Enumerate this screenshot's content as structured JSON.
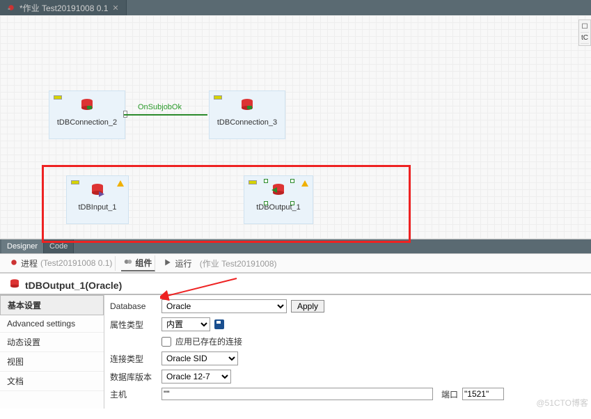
{
  "top_tab": {
    "title": "*作业 Test20191008 0.1"
  },
  "side_mini": {
    "item1": "☐",
    "item2": "tC"
  },
  "nodes": {
    "conn2": "tDBConnection_2",
    "conn3": "tDBConnection_3",
    "input1": "tDBInput_1",
    "output1": "tDBOutput_1"
  },
  "link": {
    "label": "OnSubjobOk"
  },
  "mini_tabs": {
    "designer": "Designer",
    "code": "Code"
  },
  "panel_tabs": {
    "proc_prefix": "进程",
    "proc_detail": "(Test20191008 0.1)",
    "component": "组件",
    "run": "运行",
    "run_detail": "(作业 Test20191008)"
  },
  "comp_title": "tDBOutput_1(Oracle)",
  "side_list": {
    "basic": "基本设置",
    "advanced": "Advanced settings",
    "dynamic": "动态设置",
    "view": "视图",
    "doc": "文档"
  },
  "form": {
    "database_lbl": "Database",
    "database_val": "Oracle",
    "apply": "Apply",
    "attr_type_lbl": "属性类型",
    "attr_type_val": "内置",
    "use_existing": "应用已存在的连接",
    "conn_type_lbl": "连接类型",
    "conn_type_val": "Oracle SID",
    "db_version_lbl": "数据库版本",
    "db_version_val": "Oracle 12-7",
    "host_lbl": "主机",
    "host_val": "\"\"",
    "port_lbl": "端口",
    "port_val": "\"1521\""
  },
  "watermark": "@51CTO博客"
}
